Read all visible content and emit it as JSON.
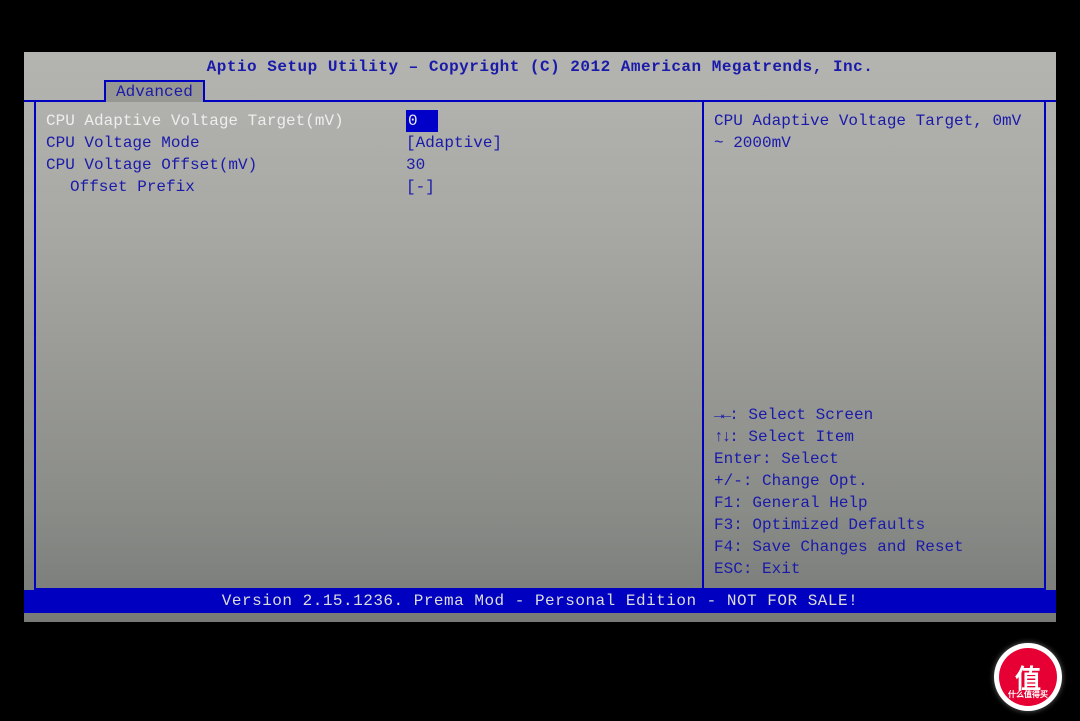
{
  "header": "Aptio Setup Utility – Copyright (C) 2012 American Megatrends, Inc.",
  "tab": "Advanced",
  "settings": [
    {
      "label": "CPU Adaptive Voltage Target(mV)",
      "value": "0",
      "selected": true,
      "indent": false
    },
    {
      "label": "CPU Voltage Mode",
      "value": "[Adaptive]",
      "selected": false,
      "indent": false
    },
    {
      "label": "CPU Voltage Offset(mV)",
      "value": "30",
      "selected": false,
      "indent": false
    },
    {
      "label": "Offset Prefix",
      "value": "[-]",
      "selected": false,
      "indent": true
    }
  ],
  "help": {
    "description": "CPU Adaptive Voltage Target, 0mV ~ 2000mV",
    "keys": [
      {
        "sym": "→←",
        "text": ": Select Screen"
      },
      {
        "sym": "↑↓",
        "text": ": Select Item"
      },
      {
        "sym": "Enter",
        "text": ": Select"
      },
      {
        "sym": "+/-",
        "text": ": Change Opt."
      },
      {
        "sym": "F1",
        "text": ": General Help"
      },
      {
        "sym": "F3",
        "text": ": Optimized Defaults"
      },
      {
        "sym": "F4",
        "text": ": Save Changes and Reset"
      },
      {
        "sym": "ESC",
        "text": ": Exit"
      }
    ]
  },
  "footer": "Version 2.15.1236. Prema Mod - Personal Edition - NOT FOR SALE!",
  "watermark": {
    "main": "值",
    "sub": "什么值得买"
  }
}
